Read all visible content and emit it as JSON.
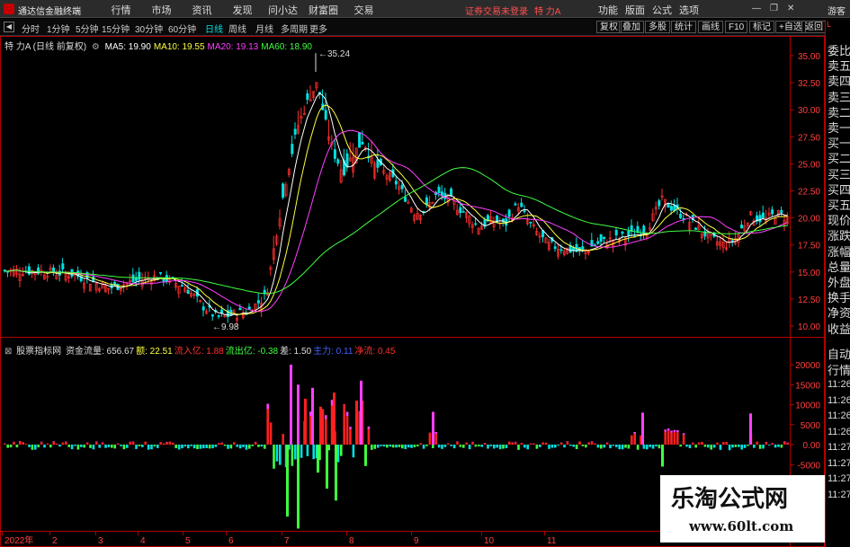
{
  "app": {
    "title": "通达信金融终端"
  },
  "menu": [
    "行情",
    "市场",
    "资讯",
    "发现",
    "问小达",
    "财富圈",
    "交易"
  ],
  "topbar": {
    "status": "证券交易未登录",
    "stock": "特 力A",
    "right_items": [
      "功能",
      "版面",
      "公式",
      "选项"
    ],
    "guest": "游客"
  },
  "periods": [
    "分时",
    "1分钟",
    "5分钟",
    "15分钟",
    "30分钟",
    "60分钟",
    "日线",
    "周线",
    "月线",
    "多周期",
    "更多"
  ],
  "active_period": "日线",
  "toolbar_right": [
    "复权",
    "叠加",
    "多股",
    "统计",
    "画线",
    "F10",
    "标记",
    "+自选",
    "返回"
  ],
  "ma": {
    "name": "特 力A (日线 前复权)",
    "items": [
      {
        "label": "MA5: 19.90",
        "color": "#ffffff"
      },
      {
        "label": "MA10: 19.55",
        "color": "#ffff40"
      },
      {
        "label": "MA20: 19.13",
        "color": "#ff40ff"
      },
      {
        "label": "MA60: 18.90",
        "color": "#40ff40"
      }
    ]
  },
  "indicator": {
    "name": "股票指标网",
    "items": [
      {
        "label": "资金流量: 656.67",
        "color": "#dddddd"
      },
      {
        "label": "额: 22.51",
        "color": "#ffff40"
      },
      {
        "label": "流入亿: 1.88",
        "color": "#ff3030"
      },
      {
        "label": "流出亿: -0.38",
        "color": "#40ff40"
      },
      {
        "label": "差: 1.50",
        "color": "#dddddd"
      },
      {
        "label": "主力: 0.11",
        "color": "#4060ff"
      },
      {
        "label": "净流: 0.45",
        "color": "#ff3030"
      }
    ]
  },
  "price_axis": [
    "35.00",
    "32.50",
    "30.00",
    "27.50",
    "25.00",
    "22.50",
    "20.00",
    "17.50",
    "15.00",
    "12.50",
    "10.00"
  ],
  "vol_axis": [
    "20000",
    "15000",
    "10000",
    "5000",
    "0.00",
    "-5000"
  ],
  "date_axis": [
    "2022年",
    "2",
    "3",
    "4",
    "5",
    "6",
    "7",
    "8",
    "9",
    "10",
    "11"
  ],
  "annotations": {
    "high": "35.24",
    "low": "9.98"
  },
  "side_labels": [
    "委比",
    "卖五",
    "卖四",
    "卖三",
    "卖二",
    "卖一",
    "买一",
    "买二",
    "买三",
    "买四",
    "买五",
    "现价",
    "涨跌",
    "涨幅",
    "总量",
    "外盘",
    "换手",
    "净资",
    "收益"
  ],
  "side_labels2": [
    "自动",
    "行情"
  ],
  "side_times": [
    "11:26",
    "11:26",
    "11:26",
    "11:26",
    "11:27",
    "11:27",
    "11:27",
    "11:27"
  ],
  "side_top": "L",
  "watermark": {
    "line1": "乐淘公式网",
    "line2": "www.60lt.com"
  },
  "colors": {
    "up": "#ff3030",
    "down": "#00e0e0",
    "ma5": "#ffffff",
    "ma10": "#ffff40",
    "ma20": "#ff40ff",
    "ma60": "#40ff40",
    "inflow": "#ff2020",
    "outflow": "#40ff40",
    "magenta": "#ff40ff"
  }
}
